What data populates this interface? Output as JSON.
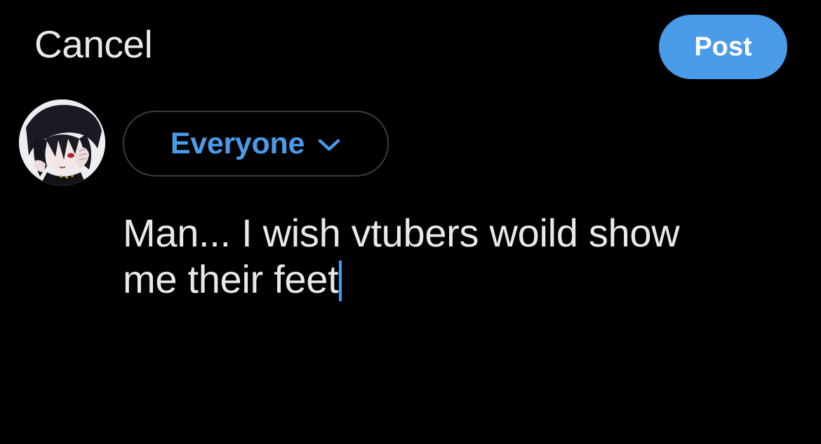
{
  "header": {
    "cancel_label": "Cancel",
    "post_label": "Post"
  },
  "audience": {
    "label": "Everyone",
    "icon": "chevron-down-icon"
  },
  "composer": {
    "line1": "Man... I wish vtubers woild show",
    "line2": "me their feet"
  },
  "colors": {
    "background": "#000000",
    "accent": "#4a9be8",
    "text": "#e7e9ea",
    "border": "#3a3d40"
  }
}
